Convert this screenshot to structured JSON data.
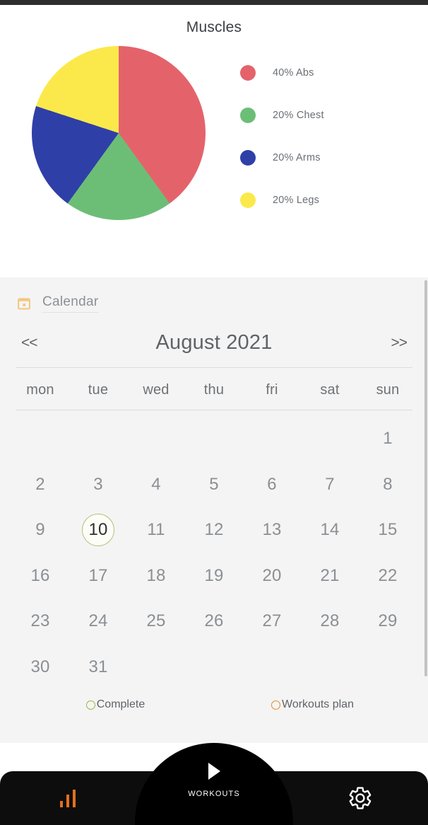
{
  "chart_card": {
    "title": "Muscles"
  },
  "chart_data": {
    "type": "pie",
    "title": "Muscles",
    "categories": [
      "Abs",
      "Chest",
      "Arms",
      "Legs"
    ],
    "values": [
      40,
      20,
      20,
      20
    ],
    "unit": "%",
    "labels": [
      "40% Abs",
      "20% Chest",
      "20% Arms",
      "20% Legs"
    ],
    "colors": [
      "#e4636b",
      "#6cbe77",
      "#2f3fa8",
      "#fbe94b"
    ],
    "legend_position": "right",
    "start_angle": 0,
    "direction": "clockwise",
    "grid": false
  },
  "calendar": {
    "section_label": "Calendar",
    "calendar_icon": "calendar-icon",
    "prev_label": "<<",
    "next_label": ">>",
    "month_title": "August 2021",
    "weekdays": [
      "mon",
      "tue",
      "wed",
      "thu",
      "fri",
      "sat",
      "sun"
    ],
    "weeks": [
      [
        "",
        "",
        "",
        "",
        "",
        "",
        "1"
      ],
      [
        "2",
        "3",
        "4",
        "5",
        "6",
        "7",
        "8"
      ],
      [
        "9",
        "10",
        "11",
        "12",
        "13",
        "14",
        "15"
      ],
      [
        "16",
        "17",
        "18",
        "19",
        "20",
        "21",
        "22"
      ],
      [
        "23",
        "24",
        "25",
        "26",
        "27",
        "28",
        "29"
      ],
      [
        "30",
        "31",
        "",
        "",
        "",
        "",
        ""
      ]
    ],
    "marked_day": "10",
    "legend": [
      {
        "label": "Complete",
        "color": "#98b84a",
        "icon": "circle-outline-icon"
      },
      {
        "label": "Workouts plan",
        "color": "#e28b2a",
        "icon": "circle-outline-icon"
      }
    ]
  },
  "bottom_nav": {
    "stats_icon": "bar-chart-icon",
    "workouts_label": "WORKOUTS",
    "play_icon": "play-icon",
    "settings_icon": "gear-icon"
  },
  "colors": {
    "accent_orange": "#e2701f",
    "panel_bg": "#f4f4f4",
    "nav_bg": "#0d0d0d"
  }
}
